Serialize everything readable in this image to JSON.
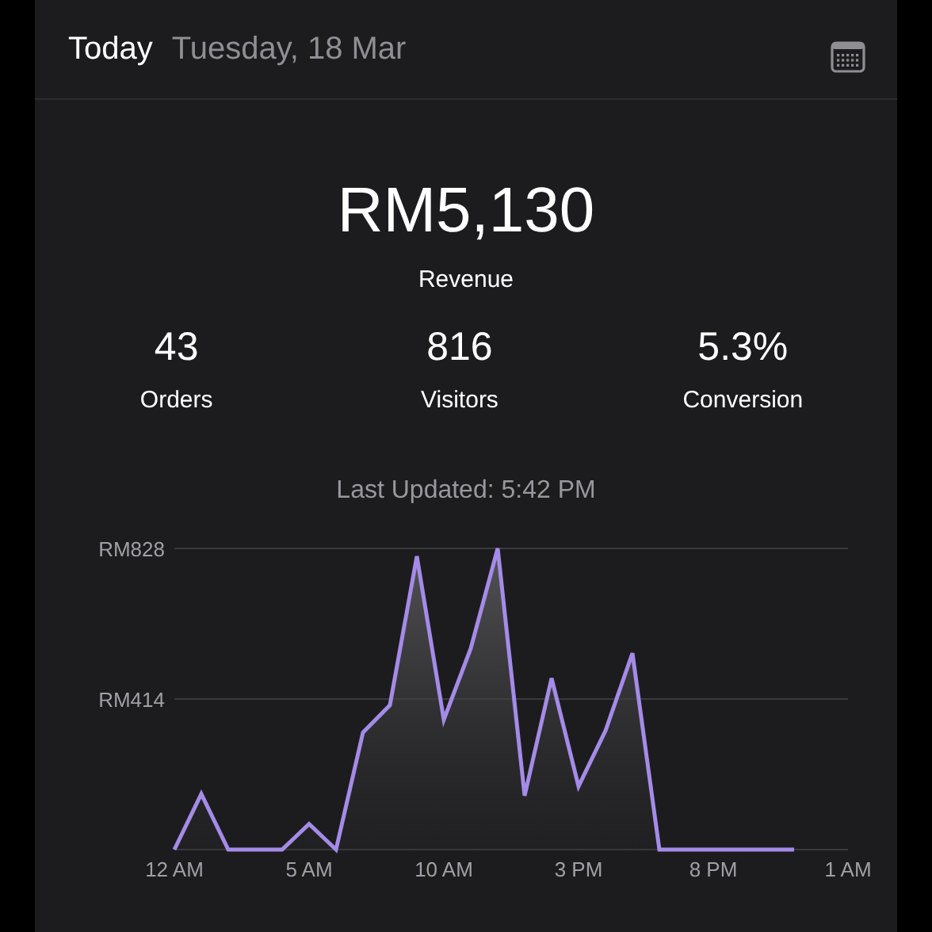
{
  "header": {
    "title": "Today",
    "date": "Tuesday, 18 Mar"
  },
  "revenue": {
    "value": "RM5,130",
    "label": "Revenue"
  },
  "stats": [
    {
      "value": "43",
      "label": "Orders"
    },
    {
      "value": "816",
      "label": "Visitors"
    },
    {
      "value": "5.3%",
      "label": "Conversion"
    }
  ],
  "last_updated": "Last Updated: 5:42 PM",
  "revenue_chart": {
    "y_axis_labels": [
      "RM828",
      "RM414"
    ],
    "x_axis_labels": [
      "12 AM",
      "5 AM",
      "10 AM",
      "3 PM",
      "8 PM",
      "1 AM"
    ]
  }
}
